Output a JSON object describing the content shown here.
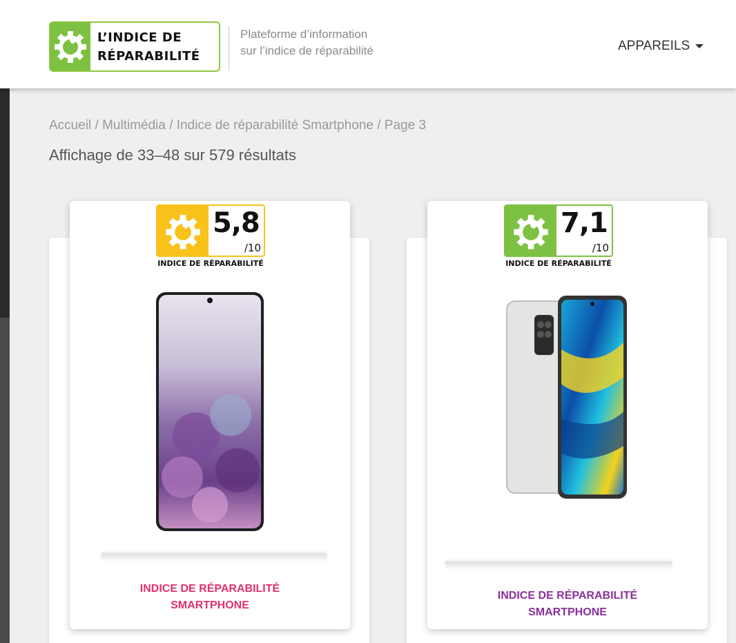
{
  "header": {
    "logo_line1": "L’INDICE DE",
    "logo_line2": "RÉPARABILITÉ",
    "tagline_line1": "Plateforme d’information",
    "tagline_line2": "sur l’indice de réparabilité",
    "nav_label": "APPAREILS"
  },
  "breadcrumb": "Accueil / Multimédia / Indice de réparabilité Smartphone / Page 3",
  "results_count": "Affichage de 33–48 sur 579 résultats",
  "products": [
    {
      "score": "5,8",
      "scale": "/10",
      "badge_label": "INDICE DE RÉPARABILITÉ",
      "badge_color": "#f9c21b",
      "title_line1": "INDICE DE RÉPARABILITÉ",
      "title_line2": "SMARTPHONE",
      "title_color": "#e0316b"
    },
    {
      "score": "7,1",
      "scale": "/10",
      "badge_label": "INDICE DE RÉPARABILITÉ",
      "badge_color": "#7dc142",
      "title_line1": "INDICE DE RÉPARABILITÉ",
      "title_line2": "SMARTPHONE",
      "title_color": "#8a2f9c"
    }
  ]
}
